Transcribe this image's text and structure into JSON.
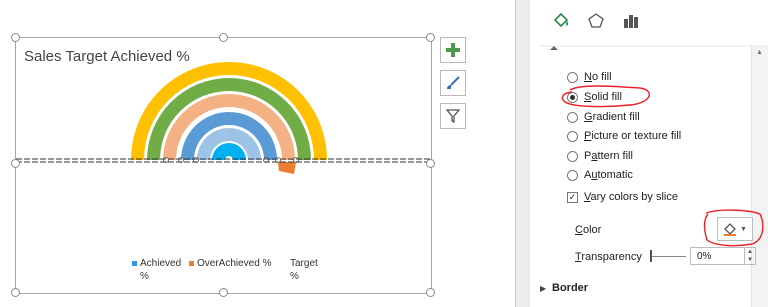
{
  "chart": {
    "title": "Sales Target Achieved %",
    "legend": [
      {
        "label_line1": "Achieved",
        "label_line2": "%",
        "color": "#2e9ae8"
      },
      {
        "label_line1": "OverAchieved %",
        "label_line2": "",
        "color": "#ed7d31"
      },
      {
        "label_line1": "Target",
        "label_line2": "%",
        "color": "#ffffff"
      }
    ],
    "ring_colors": [
      "#ffc000",
      "#70ad47",
      "#f4b183",
      "#5b9bd5",
      "#9dc3e6",
      "#00b0f0"
    ],
    "over_achieved_color": "#ed7d31"
  },
  "chart_tools": [
    {
      "name": "chart-elements-button",
      "icon": "plus-icon"
    },
    {
      "name": "chart-styles-button",
      "icon": "brush-icon"
    },
    {
      "name": "chart-filters-button",
      "icon": "funnel-icon"
    }
  ],
  "format_pane": {
    "tabs": [
      "fill-line-icon",
      "effects-pentagon-icon",
      "series-options-icon"
    ],
    "fill_options": [
      {
        "label": "No fill",
        "accel": "N",
        "selected": false
      },
      {
        "label": "Solid fill",
        "accel": "S",
        "selected": true
      },
      {
        "label": "Gradient fill",
        "accel": "G",
        "selected": false
      },
      {
        "label": "Picture or texture fill",
        "accel": "P",
        "selected": false
      },
      {
        "label": "Pattern fill",
        "accel": "A",
        "selected": false
      },
      {
        "label": "Automatic",
        "accel": "U",
        "selected": false
      }
    ],
    "vary_colors_label": "Vary colors by slice",
    "vary_colors_checked": true,
    "color_label": "Color",
    "transparency_label": "Transparency",
    "transparency_value": "0%",
    "border_section": "Border"
  }
}
